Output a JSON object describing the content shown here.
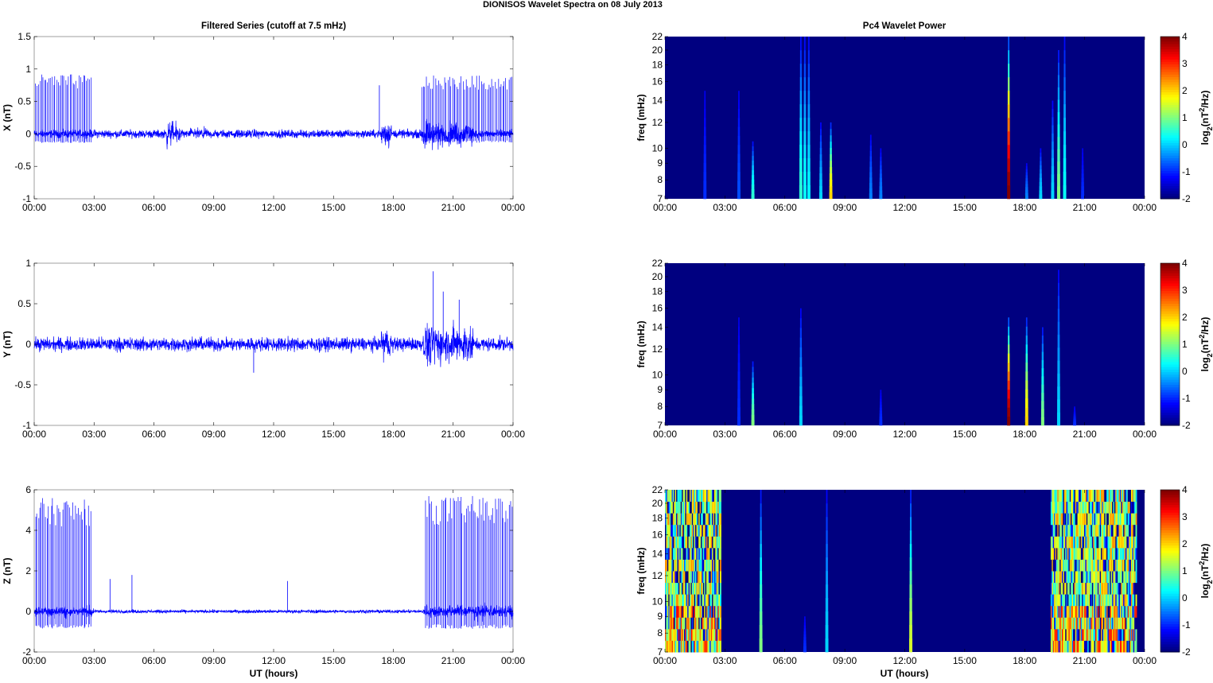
{
  "figure_title": "DIONISOS Wavelet Spectra on 08 July     2013",
  "left_title": "Filtered Series (cutoff at 7.5 mHz)",
  "right_title": "Pc4 Wavelet Power",
  "x_label": "UT (hours)",
  "x_ticks": [
    "00:00",
    "03:00",
    "06:00",
    "09:00",
    "12:00",
    "15:00",
    "18:00",
    "21:00",
    "00:00"
  ],
  "colorbar": {
    "label": "log2(nT²/Hz)",
    "ticks": [
      "4",
      "3",
      "2",
      "1",
      "0",
      "-1",
      "-2"
    ],
    "range": [
      -2,
      4
    ]
  },
  "freq_axis": {
    "label": "freq (mHz)",
    "ticks": [
      22,
      20,
      18,
      16,
      14,
      12,
      10,
      9,
      8,
      7
    ],
    "range": [
      7,
      22
    ],
    "scale": "log"
  },
  "line_color": "#0000ff",
  "chart_data": [
    {
      "type": "line",
      "component": "X",
      "ylabel": "X (nT)",
      "ylim": [
        -1,
        1.5
      ],
      "yticks": [
        "1.5",
        "1",
        "0.5",
        "0",
        "-0.5",
        "-1"
      ],
      "xlim_hours": [
        0,
        24
      ],
      "noise_amp": 0.09,
      "bursts": [
        {
          "start": 6.6,
          "end": 7.3,
          "amp": 0.35
        },
        {
          "start": 7.8,
          "end": 8.8,
          "amp": 0.15
        },
        {
          "start": 17.4,
          "end": 17.9,
          "amp": 0.5
        },
        {
          "start": 19.5,
          "end": 22,
          "amp": 0.35
        }
      ],
      "spike_bands": [
        {
          "start": 0.05,
          "end": 2.9,
          "amp": 0.92,
          "count": 38
        },
        {
          "start": 19.4,
          "end": 24,
          "amp": 0.9,
          "count": 60
        }
      ],
      "spikes": [
        {
          "t": 17.3,
          "amp": 0.75
        }
      ]
    },
    {
      "type": "line",
      "component": "Y",
      "ylabel": "Y (nT)",
      "ylim": [
        -1,
        1
      ],
      "yticks": [
        "1",
        "0.5",
        "0",
        "-0.5",
        "-1"
      ],
      "xlim_hours": [
        0,
        24
      ],
      "noise_amp": 0.12,
      "bursts": [
        {
          "start": 17.4,
          "end": 17.9,
          "amp": 0.4
        },
        {
          "start": 19.5,
          "end": 22,
          "amp": 0.45
        }
      ],
      "spike_bands": [],
      "spikes": [
        {
          "t": 20.0,
          "amp": 0.9
        },
        {
          "t": 20.5,
          "amp": 0.65
        },
        {
          "t": 21.3,
          "amp": 0.55
        },
        {
          "t": 11.0,
          "amp": -0.35
        }
      ]
    },
    {
      "type": "line",
      "component": "Z",
      "ylabel": "Z (nT)",
      "ylim": [
        -2,
        6
      ],
      "yticks": [
        "6",
        "4",
        "2",
        "0",
        "-2"
      ],
      "xlim_hours": [
        0,
        24
      ],
      "noise_amp": 0.12,
      "bursts": [
        {
          "start": 0,
          "end": 3,
          "amp": 0.5
        },
        {
          "start": 19.5,
          "end": 24,
          "amp": 0.6
        }
      ],
      "spike_bands": [
        {
          "start": 0.05,
          "end": 2.9,
          "amp": 5.6,
          "count": 40
        },
        {
          "start": 19.6,
          "end": 24,
          "amp": 5.7,
          "count": 60
        }
      ],
      "spikes": [
        {
          "t": 3.8,
          "amp": 1.6
        },
        {
          "t": 4.9,
          "amp": 1.8
        },
        {
          "t": 12.7,
          "amp": 1.5
        }
      ]
    },
    {
      "type": "heatmap",
      "component": "X",
      "ylabel": "freq (mHz)",
      "flim": [
        7,
        22
      ],
      "clim": [
        -2,
        4
      ],
      "background": -2,
      "streaks": [
        {
          "t": 2.0,
          "p": -1,
          "f": 15
        },
        {
          "t": 3.7,
          "p": -0.8,
          "f": 15
        },
        {
          "t": 4.4,
          "p": 0.5,
          "f": 10.5
        },
        {
          "t": 6.8,
          "p": 0.5,
          "f": 22
        },
        {
          "t": 7.0,
          "p": 0.3,
          "f": 22
        },
        {
          "t": 7.2,
          "p": 0.2,
          "f": 22
        },
        {
          "t": 7.8,
          "p": 0,
          "f": 12
        },
        {
          "t": 8.3,
          "p": 2,
          "f": 12
        },
        {
          "t": 10.3,
          "p": -0.5,
          "f": 11
        },
        {
          "t": 10.8,
          "p": -0.5,
          "f": 10
        },
        {
          "t": 17.2,
          "p": 4,
          "f": 22
        },
        {
          "t": 18.1,
          "p": -0.5,
          "f": 9
        },
        {
          "t": 18.8,
          "p": 0,
          "f": 10
        },
        {
          "t": 19.4,
          "p": 0,
          "f": 14
        },
        {
          "t": 19.7,
          "p": 1,
          "f": 20
        },
        {
          "t": 20.0,
          "p": 0.3,
          "f": 22
        },
        {
          "t": 20.9,
          "p": -1,
          "f": 10
        }
      ],
      "bands": []
    },
    {
      "type": "heatmap",
      "component": "Y",
      "ylabel": "freq (mHz)",
      "flim": [
        7,
        22
      ],
      "clim": [
        -2,
        4
      ],
      "background": -2,
      "streaks": [
        {
          "t": 3.7,
          "p": -1,
          "f": 15
        },
        {
          "t": 4.4,
          "p": 1,
          "f": 11
        },
        {
          "t": 6.8,
          "p": 0,
          "f": 16
        },
        {
          "t": 10.8,
          "p": -1,
          "f": 9
        },
        {
          "t": 17.2,
          "p": 4,
          "f": 15
        },
        {
          "t": 18.1,
          "p": 2,
          "f": 15
        },
        {
          "t": 18.9,
          "p": 1,
          "f": 14
        },
        {
          "t": 19.7,
          "p": 0,
          "f": 21
        },
        {
          "t": 20.5,
          "p": -1,
          "f": 8
        }
      ],
      "bands": []
    },
    {
      "type": "heatmap",
      "component": "Z",
      "ylabel": "freq (mHz)",
      "flim": [
        7,
        22
      ],
      "clim": [
        -2,
        4
      ],
      "background": -2,
      "streaks": [
        {
          "t": 4.8,
          "p": 1,
          "f": 22
        },
        {
          "t": 8.1,
          "p": 0,
          "f": 22
        },
        {
          "t": 12.3,
          "p": 1.5,
          "f": 22
        },
        {
          "t": 7.0,
          "p": -1,
          "f": 9
        }
      ],
      "bands": [
        {
          "start": 0,
          "end": 2.8,
          "p": 2.5
        },
        {
          "start": 19.3,
          "end": 23.6,
          "p": 2.5
        }
      ]
    }
  ]
}
